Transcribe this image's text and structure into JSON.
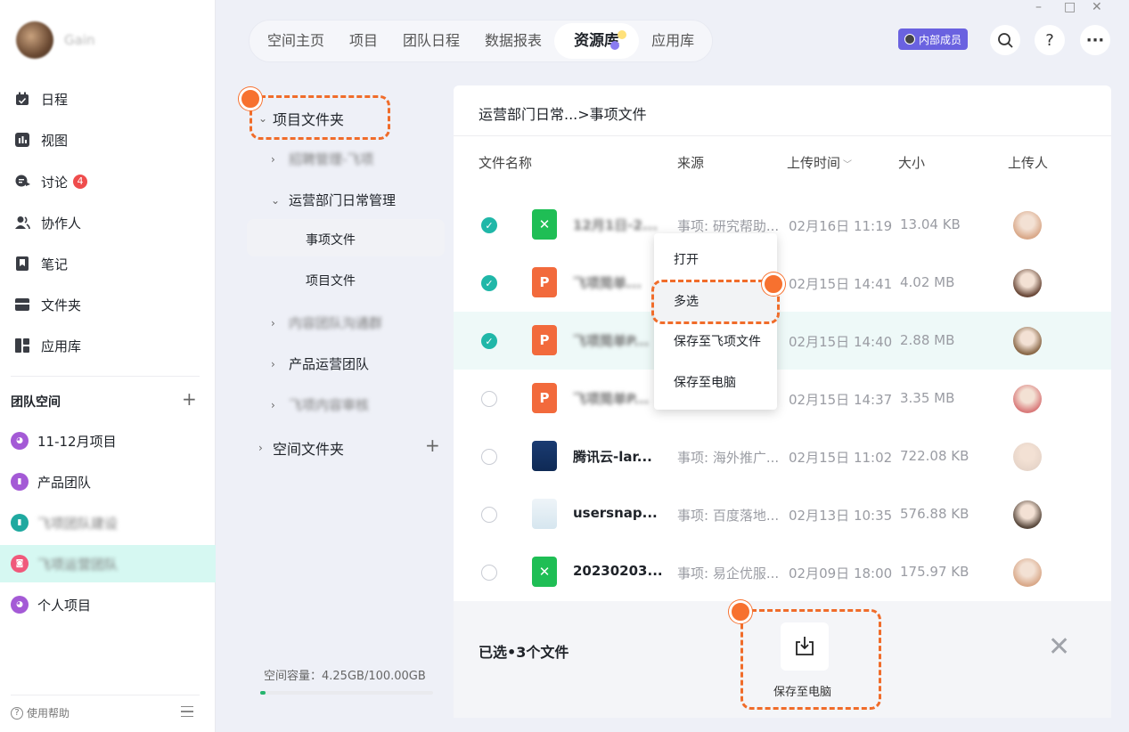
{
  "window": {
    "minimize": "–",
    "maximize": "□",
    "close": "✕"
  },
  "sidebar": {
    "user_name": "Gain",
    "nav": [
      {
        "label": "日程",
        "icon": "calendar-icon"
      },
      {
        "label": "视图",
        "icon": "chart-icon"
      },
      {
        "label": "讨论",
        "icon": "discussion-icon",
        "badge": "4"
      },
      {
        "label": "协作人",
        "icon": "people-icon"
      },
      {
        "label": "笔记",
        "icon": "bookmark-icon"
      },
      {
        "label": "文件夹",
        "icon": "folder-icon"
      },
      {
        "label": "应用库",
        "icon": "apps-icon"
      }
    ],
    "team_title": "团队空间",
    "team_add": "+",
    "teams": [
      {
        "label": "11-12月项目",
        "color": "#a45ad6"
      },
      {
        "label": "产品团队",
        "color": "#a45ad6"
      },
      {
        "label": "飞项团队建设",
        "color": "#1fa9a0"
      },
      {
        "label": "飞项运营团队",
        "color": "#f0597b"
      },
      {
        "label": "个人项目",
        "color": "#a45ad6"
      }
    ],
    "help": "使用帮助"
  },
  "top_tabs": [
    "空间主页",
    "项目",
    "团队日程",
    "数据报表",
    "资源库",
    "应用库"
  ],
  "active_tab": "资源库",
  "member_badge": "内部成员",
  "top_icons": {
    "search": "search-icon",
    "help": "?",
    "more": "···"
  },
  "tree": {
    "root": "项目文件夹",
    "blurred1": "招聘管理-飞项",
    "group": "运营部门日常管理",
    "child_selected": "事项文件",
    "child2": "项目文件",
    "blurred2": "内容团队沟通群",
    "group2": "产品运营团队",
    "blurred3": "飞项内容审核",
    "space_folder": "空间文件夹",
    "space_add": "+",
    "capacity": "空间容量：4.25GB/100.00GB",
    "capacity_fraction": 0.0425
  },
  "main": {
    "breadcrumb": "运营部门日常...>事项文件",
    "columns": {
      "name": "文件名称",
      "source": "来源",
      "time": "上传时间",
      "time_sort": "﹀",
      "size": "大小",
      "uploader": "上传人"
    },
    "rows": [
      {
        "checked": true,
        "type": "x",
        "name": "12月1日-2...",
        "blur": true,
        "source": "事项: 研究帮助...",
        "time": "02月16日 11:19",
        "size": "13.04 KB",
        "avatar": "#d9a98a"
      },
      {
        "checked": true,
        "type": "p",
        "name": "飞项简单...",
        "blur": true,
        "source": "",
        "time": "02月15日 14:41",
        "size": "4.02 MB",
        "avatar": "#6b4a3a"
      },
      {
        "checked": true,
        "type": "p",
        "name": "飞项简单P...",
        "blur": true,
        "source": "",
        "time": "02月15日 14:40",
        "size": "2.88 MB",
        "avatar": "#8b6a4a",
        "highlight": true
      },
      {
        "checked": false,
        "type": "p",
        "name": "飞项简单P...",
        "blur": true,
        "source": "",
        "time": "02月15日 14:37",
        "size": "3.35 MB",
        "avatar": "#d97b7b"
      },
      {
        "checked": false,
        "type": "img1",
        "name": "腾讯云-lar...",
        "blur": false,
        "source": "事项: 海外推广...",
        "time": "02月15日 11:02",
        "size": "722.08 KB",
        "avatar": "#e7d5c9"
      },
      {
        "checked": false,
        "type": "img2",
        "name": "usersnap...",
        "blur": false,
        "source": "事项: 百度落地...",
        "time": "02月13日 10:35",
        "size": "576.88 KB",
        "avatar": "#5a4a3e"
      },
      {
        "checked": false,
        "type": "x",
        "name": "20230203...",
        "blur": false,
        "source": "事项: 易企优服...",
        "time": "02月09日 18:00",
        "size": "175.97 KB",
        "avatar": "#d9a98a"
      }
    ],
    "file_icon_letters": {
      "x": "✕",
      "p": "P"
    }
  },
  "context_menu": [
    "打开",
    "多选",
    "保存至飞项文件",
    "保存至电脑"
  ],
  "bottom": {
    "selected": "已选•3个文件",
    "save": "保存至电脑",
    "close": "✕"
  }
}
